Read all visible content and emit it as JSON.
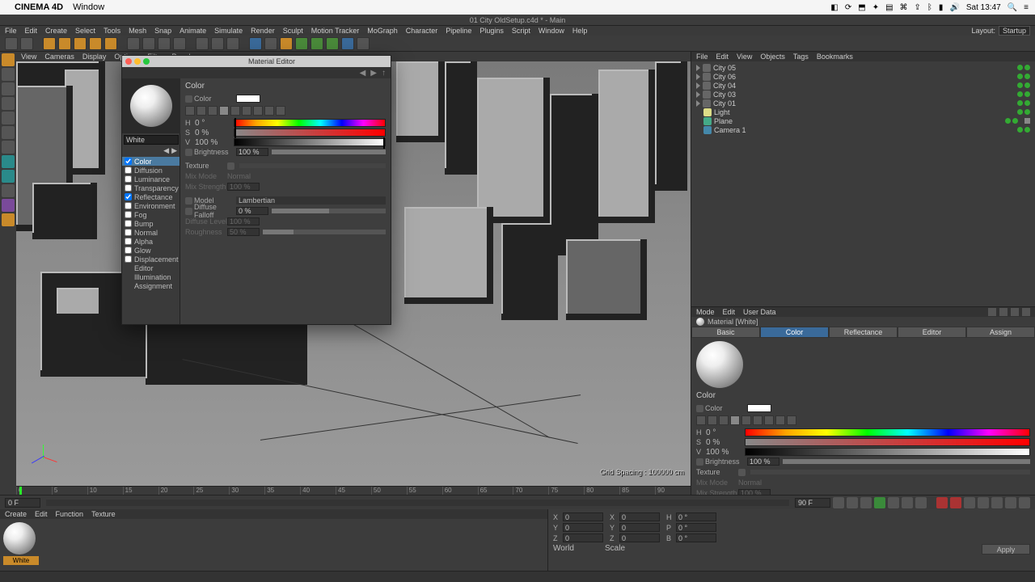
{
  "mac": {
    "app": "CINEMA 4D",
    "menu": "Window",
    "clock": "Sat 13:47"
  },
  "title": "01 City OldSetup.c4d * - Main",
  "appMenu": [
    "File",
    "Edit",
    "Create",
    "Select",
    "Tools",
    "Mesh",
    "Snap",
    "Animate",
    "Simulate",
    "Render",
    "Sculpt",
    "Motion Tracker",
    "MoGraph",
    "Character",
    "Pipeline",
    "Plugins",
    "Script",
    "Window",
    "Help"
  ],
  "layoutLabel": "Layout:",
  "layoutValue": "Startup",
  "viewportMenus": [
    "View",
    "Cameras",
    "Display",
    "Options",
    "Filter",
    "Panel"
  ],
  "gridSpacing": "Grid Spacing : 100000 cm",
  "materialEditor": {
    "title": "Material Editor",
    "matName": "White",
    "channels": [
      "Color",
      "Diffusion",
      "Luminance",
      "Transparency",
      "Reflectance",
      "Environment",
      "Fog",
      "Bump",
      "Normal",
      "Alpha",
      "Glow",
      "Displacement",
      "Editor",
      "Illumination",
      "Assignment"
    ],
    "channelsChecked": [
      true,
      false,
      false,
      false,
      true,
      false,
      false,
      false,
      false,
      false,
      false,
      false,
      null,
      null,
      null
    ],
    "selectedChannel": 0,
    "section": "Color",
    "rows": {
      "colorLabel": "Color",
      "h": "H",
      "hv": "0 °",
      "s": "S",
      "sv": "0 %",
      "v": "V",
      "vv": "100 %",
      "brightness": "Brightness",
      "brightnessV": "100 %",
      "texture": "Texture",
      "mixMode": "Mix Mode",
      "mixModeV": "Normal",
      "mixStrength": "Mix Strength",
      "mixStrengthV": "100 %",
      "model": "Model",
      "modelV": "Lambertian",
      "diffFalloff": "Diffuse Falloff",
      "diffFalloffV": "0 %",
      "diffLevel": "Diffuse Level",
      "diffLevelV": "100 %",
      "roughness": "Roughness",
      "roughnessV": "50 %"
    }
  },
  "objectMgr": {
    "tabs": [
      "File",
      "Edit",
      "View",
      "Objects",
      "Tags",
      "Bookmarks"
    ],
    "items": [
      {
        "name": "City 05",
        "dots": [
          "g",
          "g"
        ]
      },
      {
        "name": "City 06",
        "dots": [
          "g",
          "g"
        ]
      },
      {
        "name": "City 04",
        "dots": [
          "g",
          "g"
        ]
      },
      {
        "name": "City 03",
        "dots": [
          "g",
          "g"
        ]
      },
      {
        "name": "City 01",
        "dots": [
          "g",
          "g"
        ]
      },
      {
        "name": "Light",
        "dots": [
          "g",
          "g"
        ]
      },
      {
        "name": "Plane",
        "dots": [
          "g",
          "g"
        ]
      },
      {
        "name": "Camera 1",
        "dots": [
          "g",
          "g"
        ]
      }
    ]
  },
  "attrMgr": {
    "tabs": [
      "Mode",
      "Edit",
      "User Data"
    ],
    "matName": "Material [White]",
    "subTabs": [
      "Basic",
      "Color",
      "Reflectance",
      "Editor",
      "Assign"
    ],
    "activeTab": 1,
    "section": "Color"
  },
  "timeline": {
    "startFrame": "0 F",
    "endFrame": "90 F",
    "ticks": [
      0,
      5,
      10,
      15,
      20,
      25,
      30,
      35,
      40,
      45,
      50,
      55,
      60,
      65,
      70,
      75,
      80,
      85,
      90
    ]
  },
  "matMgr": {
    "tabs": [
      "Create",
      "Edit",
      "Function",
      "Texture"
    ],
    "matName": "White"
  },
  "coord": {
    "x": "X",
    "y": "Y",
    "z": "Z",
    "pos": "0",
    "size": "0",
    "rot": "0 °",
    "posLabel": "World",
    "sizeLabel": "Scale",
    "h": "H",
    "p": "P",
    "b": "B",
    "apply": "Apply"
  }
}
